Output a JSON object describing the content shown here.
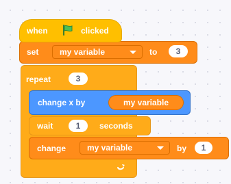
{
  "script": {
    "hat": {
      "when": "when",
      "clicked": "clicked",
      "flag_icon": "green-flag-icon"
    },
    "set": {
      "label": "set",
      "variable": "my variable",
      "to": "to",
      "value": "3"
    },
    "repeat": {
      "label": "repeat",
      "count": "3",
      "arrow_icon": "repeat-arrow-icon"
    },
    "change_x": {
      "label": "change x by",
      "reporter": "my variable"
    },
    "wait": {
      "label": "wait",
      "value": "1",
      "unit": "seconds"
    },
    "change_var": {
      "label": "change",
      "variable": "my variable",
      "by": "by",
      "value": "1"
    }
  },
  "colors": {
    "events": "#ffbf00",
    "variables": "#ff8c1a",
    "control": "#ffab19",
    "motion": "#4c97ff"
  }
}
